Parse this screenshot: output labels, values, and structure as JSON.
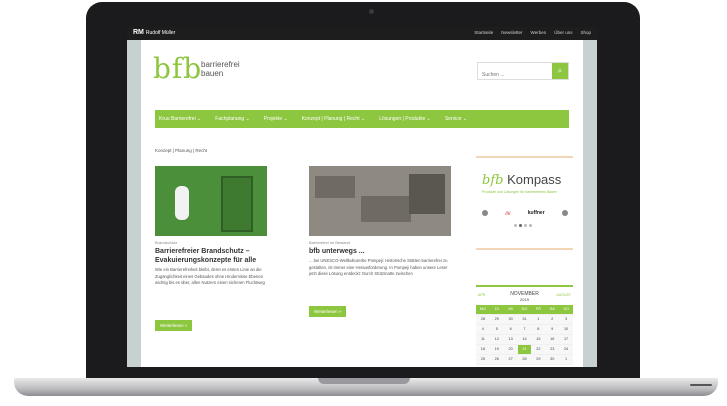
{
  "site": {
    "brand": "RM",
    "brand_sub": "Rudolf Müller",
    "top_links": [
      "Startseite",
      "Newsletter",
      "Werben",
      "Über uns",
      "Shop"
    ]
  },
  "logo": {
    "text": "bfb",
    "tagline": "barrierefrei bauen"
  },
  "search": {
    "placeholder": "Suchen ...",
    "button_icon": "search-icon"
  },
  "nav": {
    "items": [
      "Kruu Barrierefrei ⌄",
      "Fachplanung ⌄",
      "Projekte ⌄",
      "Konzept | Planung | Recht ⌄",
      "Lösungen | Produkte ⌄",
      "Service ⌄"
    ]
  },
  "breadcrumb": "Konzept | Planung | Recht",
  "posts": [
    {
      "category": "Brandschutz",
      "title": "Barrierefreier Brandschutz – Evakuierungskonzepte für alle",
      "excerpt": "Wie ein Barrierefreiheit bleibt, deret es ersten Linie an die Zugänglichkeit eines Gebäudes ohne Hindernisse Ebenen wichtig bis es über, allen Nutzern einen sicheren Fluchtweg",
      "more": "Weiterlesen »"
    },
    {
      "category": "Barrierefrei im Bestand",
      "title": "bfb unterwegs ...",
      "excerpt": "... bei UNESCO-Weltkulturerbe Pompeji: Historische Stätten barrierefrei zu gestalten, ist immer eine Herausforderung. In Pompeji haben unsere Leser jetzt diese Lösung entdeckt: Durch Stützmatte zwischen",
      "more": "Weiterlesen »"
    }
  ],
  "kompass": {
    "title_a": "bfb",
    "title_b": "Kompass",
    "subtitle": "Produkte und Lösungen für barrierefreies Bauen",
    "logo_1": "////",
    "logo_2": "kuffner"
  },
  "calendar": {
    "month": "NOVEMBER",
    "year": "2019",
    "prev": "APR",
    "next": "AUGUST",
    "days_header": [
      "MO",
      "DI",
      "MI",
      "DO",
      "FR",
      "SA",
      "SO"
    ],
    "rows": [
      [
        "28",
        "29",
        "30",
        "31",
        "1",
        "2",
        "3"
      ],
      [
        "4",
        "5",
        "6",
        "7",
        "8",
        "9",
        "10"
      ],
      [
        "11",
        "12",
        "13",
        "14",
        "15",
        "16",
        "17"
      ],
      [
        "18",
        "19",
        "20",
        "21",
        "22",
        "23",
        "24"
      ],
      [
        "25",
        "26",
        "27",
        "28",
        "29",
        "30",
        "1"
      ]
    ],
    "today": "21"
  }
}
